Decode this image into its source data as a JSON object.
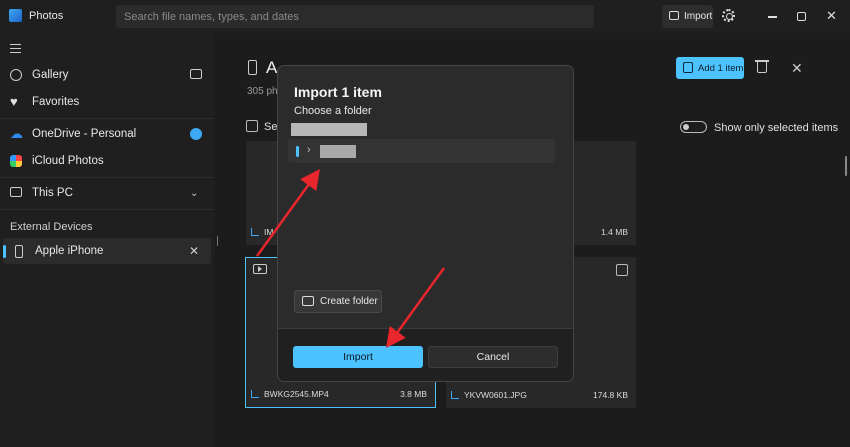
{
  "window": {
    "app_title": "Photos",
    "search_placeholder": "Search file names, types, and dates",
    "import_label": "Import"
  },
  "sidebar": {
    "items": [
      {
        "label": "Gallery",
        "icon": "gallery-icon"
      },
      {
        "label": "Favorites",
        "icon": "heart-icon"
      },
      {
        "label": "OneDrive - Personal",
        "icon": "cloud-icon"
      },
      {
        "label": "iCloud Photos",
        "icon": "icloud-icon"
      },
      {
        "label": "This PC",
        "icon": "pc-icon"
      }
    ],
    "section_title": "External Devices",
    "device": {
      "label": "Apple iPhone",
      "icon": "phone-icon"
    }
  },
  "main": {
    "title": "A",
    "count": "305 pho",
    "select_label": "Sel",
    "add_button": "Add 1 item",
    "toggle_label": "Show only selected items",
    "tiles": [
      {
        "name": "IM",
        "size": "1.4 MB"
      },
      {
        "name": "BWKG2545.MP4",
        "size": "3.8 MB",
        "selected": true
      },
      {
        "name": "YKVW0601.JPG",
        "size": "174.8 KB"
      }
    ]
  },
  "dialog": {
    "title": "Import 1 item",
    "subtitle": "Choose a folder",
    "create_folder": "Create folder",
    "primary_button": "Import",
    "secondary_button": "Cancel"
  },
  "colors": {
    "accent": "#4cc2ff",
    "annotation_arrow": "#e8262c"
  }
}
